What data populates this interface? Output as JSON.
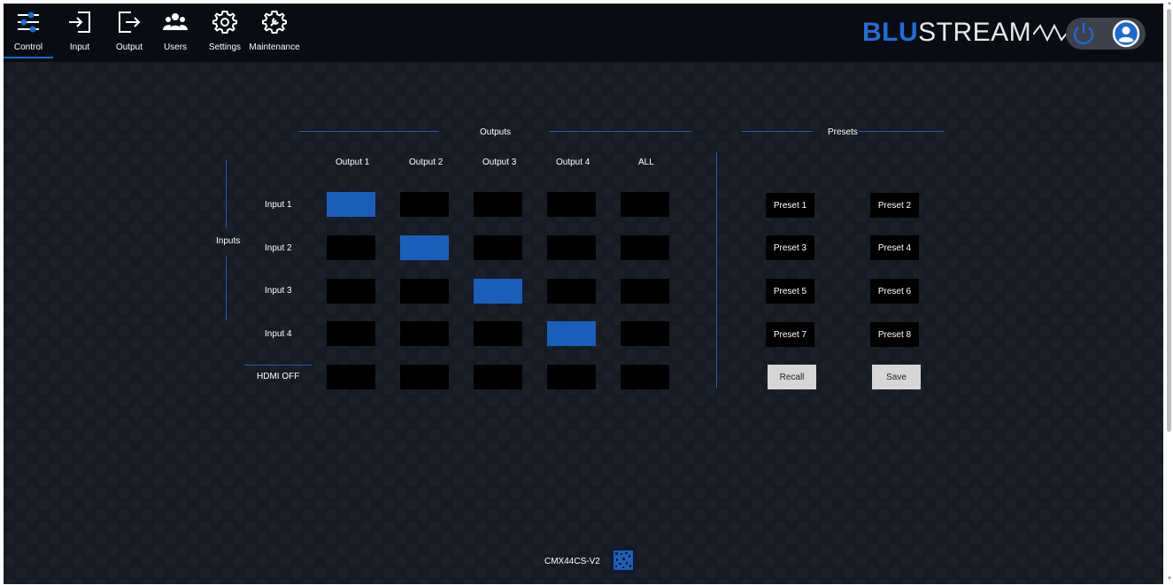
{
  "nav": {
    "items": [
      {
        "label": "Control",
        "icon": "sliders-icon"
      },
      {
        "label": "Input",
        "icon": "input-icon"
      },
      {
        "label": "Output",
        "icon": "output-icon"
      },
      {
        "label": "Users",
        "icon": "users-icon"
      },
      {
        "label": "Settings",
        "icon": "gear-icon"
      },
      {
        "label": "Maintenance",
        "icon": "wrench-gear-icon"
      }
    ],
    "active": "Control"
  },
  "logo": {
    "blu": "BLU",
    "stream": "STREAM"
  },
  "colors": {
    "accent": "#1b6ad1",
    "route_on": "#1a5ebc",
    "cell_off": "#000000",
    "background": "#161a23"
  },
  "matrix": {
    "outputs_title": "Outputs",
    "inputs_title": "Inputs",
    "columns": [
      "Output 1",
      "Output 2",
      "Output 3",
      "Output 4",
      "ALL"
    ],
    "rows": [
      "Input 1",
      "Input 2",
      "Input 3",
      "Input 4",
      "HDMI OFF"
    ],
    "routes": [
      [
        true,
        false,
        false,
        false,
        false
      ],
      [
        false,
        true,
        false,
        false,
        false
      ],
      [
        false,
        false,
        true,
        false,
        false
      ],
      [
        false,
        false,
        false,
        true,
        false
      ],
      [
        false,
        false,
        false,
        false,
        false
      ]
    ]
  },
  "presets": {
    "title": "Presets",
    "items": [
      "Preset 1",
      "Preset 2",
      "Preset 3",
      "Preset 4",
      "Preset 5",
      "Preset 6",
      "Preset 7",
      "Preset 8"
    ],
    "recall_label": "Recall",
    "save_label": "Save"
  },
  "footer": {
    "model": "CMX44CS-V2"
  }
}
